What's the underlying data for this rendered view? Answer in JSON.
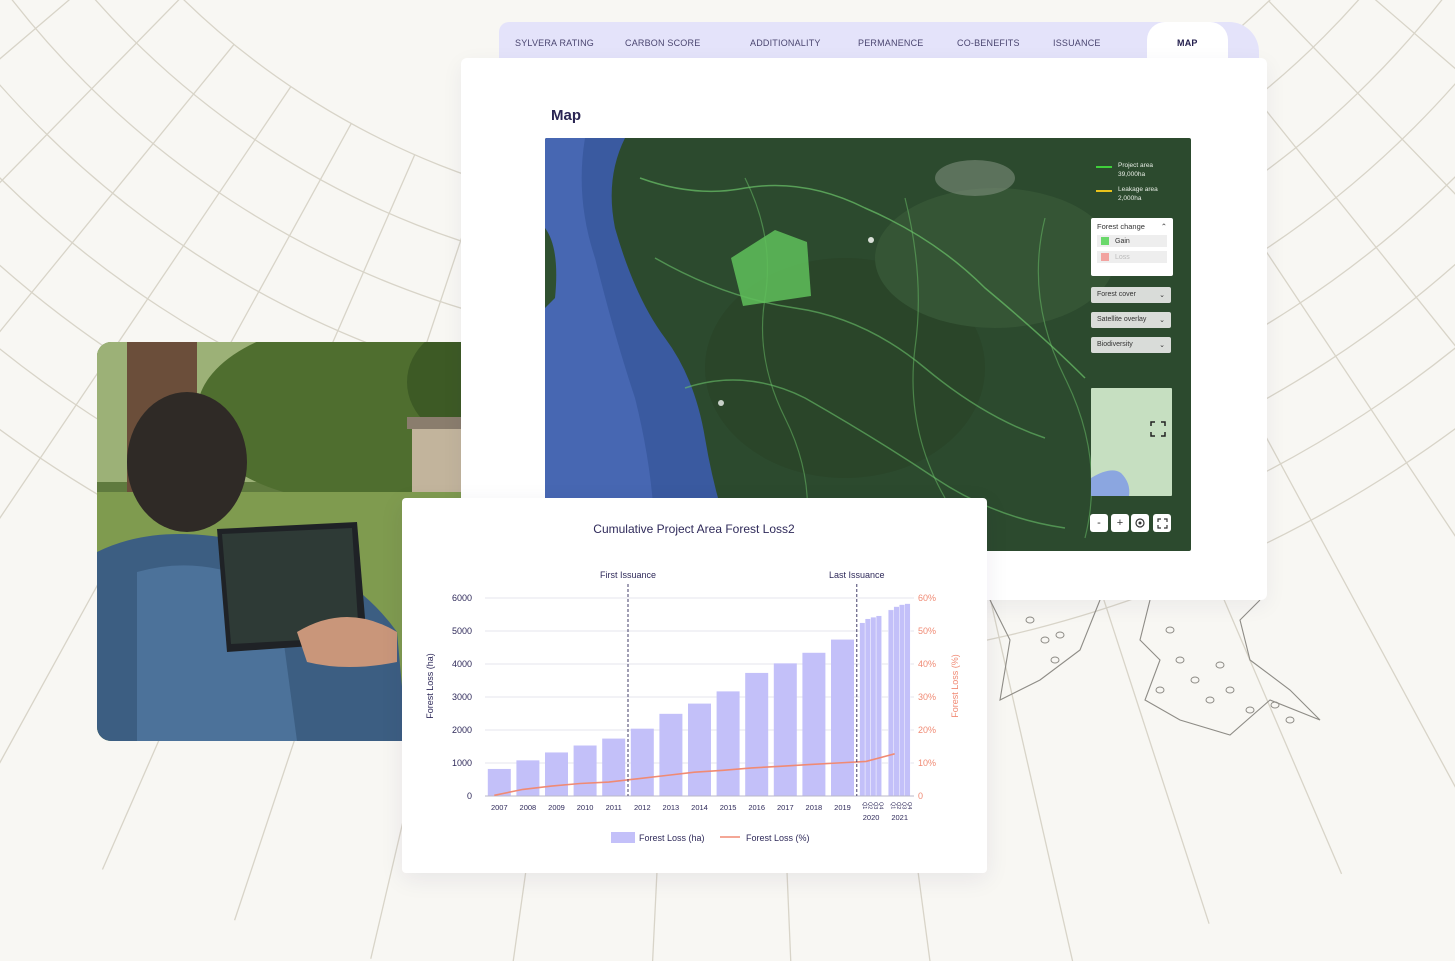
{
  "tabs": [
    {
      "label": "SYLVERA RATING"
    },
    {
      "label": "CARBON SCORE"
    },
    {
      "label": "ADDITIONALITY"
    },
    {
      "label": "PERMANENCE"
    },
    {
      "label": "CO-BENEFITS"
    },
    {
      "label": "ISSUANCE"
    },
    {
      "label": "MAP",
      "active": true
    }
  ],
  "map": {
    "title": "Map",
    "legend": [
      {
        "label": "Project area",
        "value": "39,000ha",
        "color": "#3fcf3a"
      },
      {
        "label": "Leakage area",
        "value": "2,000ha",
        "color": "#e8c21b"
      }
    ],
    "forest_change": {
      "title": "Forest change",
      "items": [
        {
          "label": "Gain",
          "color": "#6ad86b"
        },
        {
          "label": "Loss",
          "color": "#f2a3a0"
        }
      ]
    },
    "dropdowns": [
      "Forest cover",
      "Satellite overlay",
      "Biodiversity"
    ],
    "controls": {
      "zoom_out": "-",
      "zoom_in": "+"
    }
  },
  "chart_data": {
    "type": "bar",
    "title": "Cumulative Project Area Forest Loss2",
    "ylabel": "Forest Loss (ha)",
    "y2label": "Forest Loss (%)",
    "ylim": [
      0,
      6000
    ],
    "y2lim": [
      0,
      60
    ],
    "yticks": [
      "0",
      "1000",
      "2000",
      "3000",
      "4000",
      "5000",
      "6000"
    ],
    "y2ticks": [
      "0",
      "10%",
      "20%",
      "30%",
      "40%",
      "50%",
      "60%"
    ],
    "categories": [
      "2007",
      "2008",
      "2009",
      "2010",
      "2011",
      "2012",
      "2013",
      "2014",
      "2015",
      "2016",
      "2017",
      "2018",
      "2019",
      "2020",
      "2021"
    ],
    "sub_periods": {
      "2020": [
        "Q1",
        "Q2",
        "Q3",
        "Q4"
      ],
      "2021": [
        "Q1",
        "Q2",
        "Q3",
        "Q4"
      ]
    },
    "series": [
      {
        "name": "Forest Loss (ha)",
        "kind": "bar",
        "color": "#c3c0f9",
        "values": [
          820,
          1080,
          1320,
          1530,
          1740,
          2040,
          2490,
          2800,
          3170,
          3730,
          4020,
          4340,
          4740,
          null,
          null
        ],
        "quarterly": {
          "2020": [
            5250,
            5370,
            5420,
            5460
          ],
          "2021": [
            5640,
            5740,
            5800,
            5830
          ]
        }
      },
      {
        "name": "Forest Loss (%)",
        "kind": "line",
        "color": "#f08a74",
        "points": [
          [
            2007,
            0.2
          ],
          [
            2008,
            2
          ],
          [
            2009,
            3
          ],
          [
            2010,
            3.8
          ],
          [
            2011,
            4.2
          ],
          [
            2012,
            5.2
          ],
          [
            2013,
            6.2
          ],
          [
            2014,
            7.2
          ],
          [
            2015,
            7.8
          ],
          [
            2016,
            8.5
          ],
          [
            2017,
            9
          ],
          [
            2018,
            9.5
          ],
          [
            2019,
            10
          ],
          [
            2020,
            10.5
          ],
          [
            2021,
            12.8
          ]
        ]
      }
    ],
    "annotations": [
      {
        "label": "First Issuance",
        "x": 2011.5
      },
      {
        "label": "Last Issuance",
        "x": 2019.5
      }
    ]
  }
}
